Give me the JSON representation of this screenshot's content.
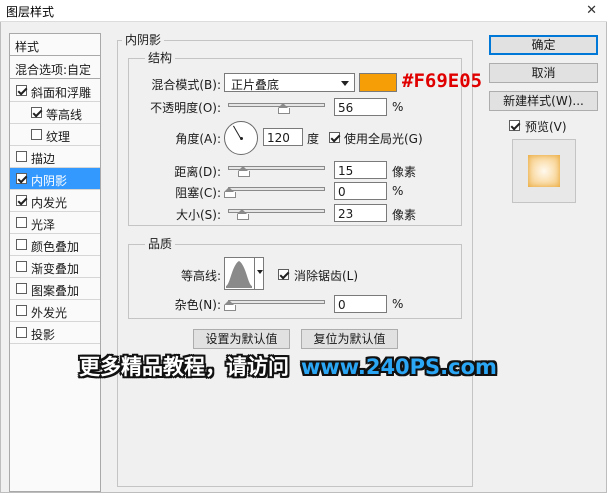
{
  "window": {
    "title": "图层样式",
    "close_glyph": "✕"
  },
  "style_list": {
    "header": "样式",
    "blend_options": "混合选项:自定",
    "items": [
      {
        "label": "斜面和浮雕",
        "checked": true
      },
      {
        "label": "等高线",
        "checked": true
      },
      {
        "label": "纹理",
        "checked": false
      },
      {
        "label": "描边",
        "checked": false
      },
      {
        "label": "内阴影",
        "checked": true,
        "selected": true
      },
      {
        "label": "内发光",
        "checked": true
      },
      {
        "label": "光泽",
        "checked": false
      },
      {
        "label": "颜色叠加",
        "checked": false
      },
      {
        "label": "渐变叠加",
        "checked": false
      },
      {
        "label": "图案叠加",
        "checked": false
      },
      {
        "label": "外发光",
        "checked": false
      },
      {
        "label": "投影",
        "checked": false
      }
    ]
  },
  "inner_shadow": {
    "group_title": "内阴影",
    "structure": {
      "title": "结构",
      "blend_mode_label": "混合模式(B):",
      "blend_mode_value": "正片叠底",
      "color_hex": "#F69E05",
      "color_annotation": "#F69E05",
      "opacity_label": "不透明度(O):",
      "opacity_value": "56",
      "opacity_unit": "%",
      "opacity_level": 0.56,
      "angle_label": "角度(A):",
      "angle_value": "120",
      "angle_unit": "度",
      "global_light_label": "使用全局光(G)",
      "global_light_checked": true,
      "distance_label": "距离(D):",
      "distance_value": "15",
      "distance_unit": "像素",
      "choke_label": "阻塞(C):",
      "choke_value": "0",
      "choke_unit": "%",
      "size_label": "大小(S):",
      "size_value": "23",
      "size_unit": "像素"
    },
    "quality": {
      "title": "品质",
      "contour_label": "等高线:",
      "anti_alias_label": "消除锯齿(L)",
      "anti_alias_checked": true,
      "noise_label": "杂色(N):",
      "noise_value": "0",
      "noise_unit": "%"
    },
    "set_default_label": "设置为默认值",
    "reset_default_label": "复位为默认值"
  },
  "buttons": {
    "ok": "确定",
    "cancel": "取消",
    "new_style": "新建样式(W)...",
    "preview_label": "预览(V)",
    "preview_checked": true
  },
  "watermark": {
    "text": "更多精品教程，请访问",
    "url": "www.240PS.com"
  },
  "colors": {
    "accent": "#3399ff",
    "swatch": "#F69E05",
    "annotation": "#e00000"
  }
}
